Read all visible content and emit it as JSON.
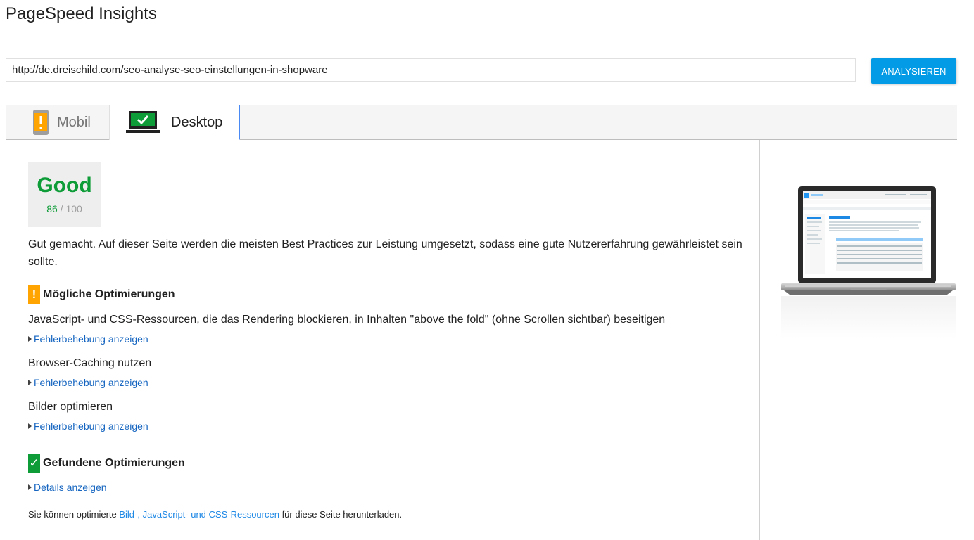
{
  "app": {
    "title": "PageSpeed Insights"
  },
  "search": {
    "url_value": "http://de.dreischild.com/seo-analyse-seo-einstellungen-in-shopware",
    "analyze_label": "ANALYSIEREN"
  },
  "tabs": [
    {
      "label": "Mobil",
      "icon": "phone-warning-icon",
      "active": false
    },
    {
      "label": "Desktop",
      "icon": "laptop-check-icon",
      "active": true
    }
  ],
  "score": {
    "label": "Good",
    "value": "86",
    "separator": "/",
    "max": "100"
  },
  "summary": "Gut gemacht. Auf dieser Seite werden die meisten Best Practices zur Leistung umgesetzt, sodass eine gute Nutzererfahrung gewährleistet sein sollte.",
  "possible": {
    "icon_text": "!",
    "heading": "Mögliche Optimierungen",
    "items": [
      {
        "title": "JavaScript- und CSS-Ressourcen, die das Rendering blockieren, in Inhalten \"above the fold\" (ohne Scrollen sichtbar) beseitigen",
        "link": "Fehlerbehebung anzeigen"
      },
      {
        "title": "Browser-Caching nutzen",
        "link": "Fehlerbehebung anzeigen"
      },
      {
        "title": "Bilder optimieren",
        "link": "Fehlerbehebung anzeigen"
      }
    ]
  },
  "found": {
    "icon_text": "✓",
    "heading": "Gefundene Optimierungen",
    "link": "Details anzeigen"
  },
  "download": {
    "prefix": "Sie können optimierte ",
    "link": "Bild-, JavaScript- und CSS-Ressourcen",
    "suffix": " für diese Seite herunterladen."
  },
  "colors": {
    "accent": "#039be5",
    "good": "#0d9c37",
    "warning": "#ffa400",
    "link": "#1565c0"
  }
}
